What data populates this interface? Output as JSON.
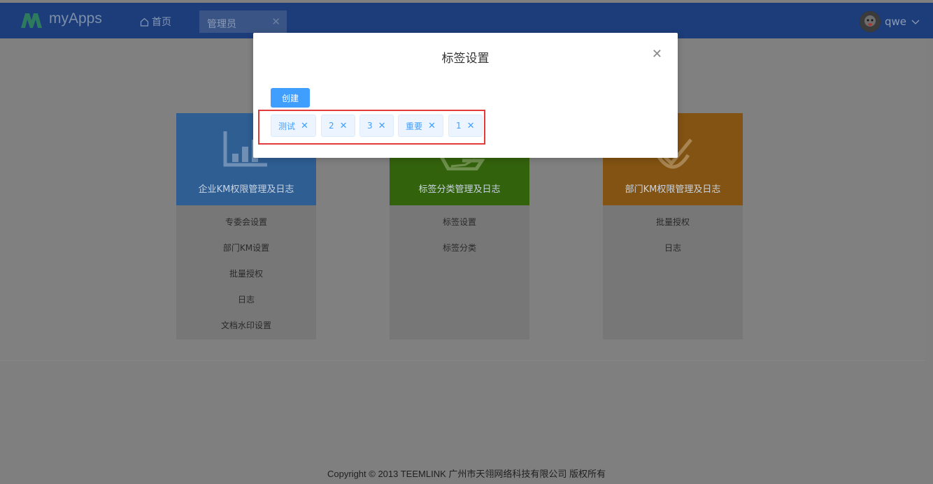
{
  "header": {
    "app_name": "myApps",
    "home_label": "首页",
    "tab_label": "管理员",
    "user_name": "qwe"
  },
  "cards": [
    {
      "title": "企业KM权限管理及日志",
      "color": "#2f5e93",
      "icon": "bar-chart-icon",
      "links": [
        "专委会设置",
        "部门KM设置",
        "批量授权",
        "日志",
        "文档水印设置"
      ]
    },
    {
      "title": "标签分类管理及日志",
      "color": "#33620c",
      "icon": "hand-icon",
      "links": [
        "标签设置",
        "标签分类"
      ]
    },
    {
      "title": "部门KM权限管理及日志",
      "color": "#825312",
      "icon": "shield-check-icon",
      "links": [
        "批量授权",
        "日志"
      ]
    }
  ],
  "modal": {
    "title": "标签设置",
    "create_label": "创建",
    "tags": [
      "测试",
      "2",
      "3",
      "重要",
      "1"
    ]
  },
  "footer": {
    "text": "Copyright © 2013 TEEMLINK 广州市天翎网络科技有限公司 版权所有"
  },
  "colors": {
    "topbar": "#1c3d7a",
    "accent": "#409eff",
    "highlight_box": "#e33b3b"
  }
}
